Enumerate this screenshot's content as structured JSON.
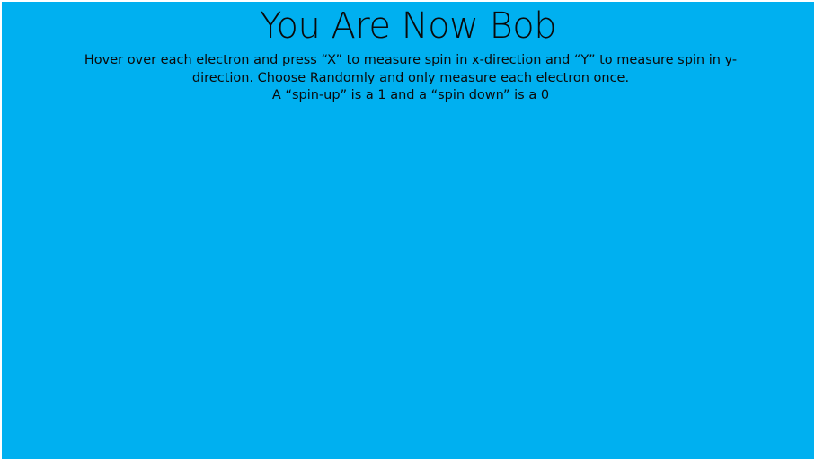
{
  "slide": {
    "title": "You Are Now Bob",
    "instruction_line1": "Hover over each electron and press “X” to measure spin in x-direction and “Y” to measure spin in y-direction. Choose Randomly and only measure each electron once.",
    "instruction_line2": "A “spin-up” is a 1 and a “spin down” is a 0"
  },
  "colors": {
    "background": "#00b0f0",
    "text": "#0a0a0a"
  }
}
